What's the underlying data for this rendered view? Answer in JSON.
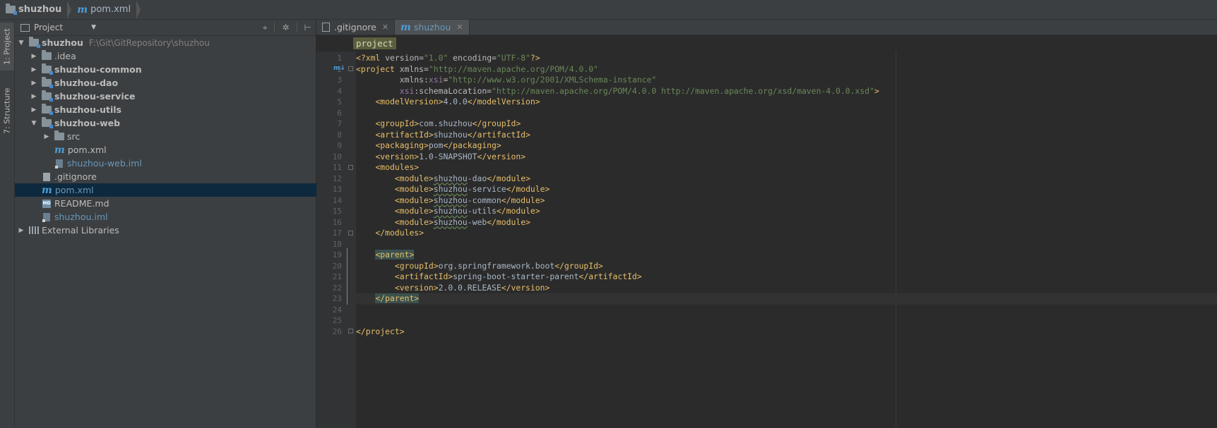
{
  "navbar": {
    "crumbs": [
      {
        "label": "shuzhou",
        "icon": "module-folder-icon"
      },
      {
        "label": "pom.xml",
        "icon": "maven-icon"
      }
    ]
  },
  "toolwindows": {
    "project_tab": "1: Project",
    "structure_tab": "7: Structure"
  },
  "project_panel": {
    "view": "Project",
    "tools": [
      "target-icon",
      "gear-icon",
      "collapse-icon"
    ],
    "tree": [
      {
        "label": "shuzhou",
        "path": "F:\\Git\\GitRepository\\shuzhou",
        "level": 0,
        "expanded": true,
        "bold": true,
        "icon": "module-folder-icon"
      },
      {
        "label": ".idea",
        "level": 1,
        "expanded": false,
        "bold": false,
        "icon": "folder-icon"
      },
      {
        "label": "shuzhou-common",
        "level": 1,
        "expanded": false,
        "bold": true,
        "icon": "module-folder-icon"
      },
      {
        "label": "shuzhou-dao",
        "level": 1,
        "expanded": false,
        "bold": true,
        "icon": "module-folder-icon"
      },
      {
        "label": "shuzhou-service",
        "level": 1,
        "expanded": false,
        "bold": true,
        "icon": "module-folder-icon"
      },
      {
        "label": "shuzhou-utils",
        "level": 1,
        "expanded": false,
        "bold": true,
        "icon": "module-folder-icon"
      },
      {
        "label": "shuzhou-web",
        "level": 1,
        "expanded": true,
        "bold": true,
        "icon": "module-folder-icon"
      },
      {
        "label": "src",
        "level": 2,
        "expanded": false,
        "bold": false,
        "icon": "folder-icon"
      },
      {
        "label": "pom.xml",
        "level": 2,
        "leaf": true,
        "icon": "maven-icon"
      },
      {
        "label": "shuzhou-web.iml",
        "level": 2,
        "leaf": true,
        "icon": "iml-file-icon",
        "blue": true
      },
      {
        "label": ".gitignore",
        "level": 1,
        "leaf": true,
        "icon": "text-file-icon"
      },
      {
        "label": "pom.xml",
        "level": 1,
        "leaf": true,
        "icon": "maven-icon",
        "selected": true
      },
      {
        "label": "README.md",
        "level": 1,
        "leaf": true,
        "icon": "markdown-file-icon"
      },
      {
        "label": "shuzhou.iml",
        "level": 1,
        "leaf": true,
        "icon": "iml-file-icon",
        "blue": true
      },
      {
        "label": "External Libraries",
        "level": 0,
        "expanded": false,
        "bold": false,
        "icon": "library-icon"
      }
    ]
  },
  "editor": {
    "tabs": [
      {
        "label": ".gitignore",
        "icon": "text-file-icon",
        "active": false
      },
      {
        "label": "shuzhou",
        "icon": "maven-icon",
        "active": true
      }
    ],
    "breadcrumb": "project",
    "lines": [
      "1",
      "2",
      "3",
      "4",
      "5",
      "6",
      "7",
      "8",
      "9",
      "10",
      "11",
      "12",
      "13",
      "14",
      "15",
      "16",
      "17",
      "18",
      "19",
      "20",
      "21",
      "22",
      "23",
      "24",
      "25",
      "26"
    ],
    "code": {
      "l1": {
        "pi_open": "<?xml ",
        "v_attr": "version=",
        "v_val": "\"1.0\"",
        "e_attr": " encoding=",
        "e_val": "\"UTF-8\"",
        "pi_close": "?>"
      },
      "l2": {
        "open": "<project ",
        "attr": "xmlns=",
        "val": "\"http://maven.apache.org/POM/4.0.0\""
      },
      "l3": {
        "indent": "         ",
        "attr": "xmlns:",
        "ns": "xsi",
        "eq": "=",
        "val": "\"http://www.w3.org/2001/XMLSchema-instance\""
      },
      "l4": {
        "indent": "         ",
        "ns": "xsi",
        "attr": ":schemaLocation=",
        "val": "\"http://maven.apache.org/POM/4.0.0 http://maven.apache.org/xsd/maven-4.0.0.xsd\"",
        "close": ">"
      },
      "l5": {
        "indent": "    ",
        "open": "<modelVersion>",
        "text": "4.0.0",
        "close": "</modelVersion>"
      },
      "l7": {
        "indent": "    ",
        "open": "<groupId>",
        "text": "com.shuzhou",
        "close": "</groupId>"
      },
      "l8": {
        "indent": "    ",
        "open": "<artifactId>",
        "text": "shuzhou",
        "close": "</artifactId>"
      },
      "l9": {
        "indent": "    ",
        "open": "<packaging>",
        "text": "pom",
        "close": "</packaging>"
      },
      "l10": {
        "indent": "    ",
        "open": "<version>",
        "text": "1.0-SNAPSHOT",
        "close": "</version>"
      },
      "l11": {
        "indent": "    ",
        "open": "<modules>"
      },
      "l12": {
        "indent": "        ",
        "open": "<module>",
        "word": "shuzhou",
        "rest": "-dao",
        "close": "</module>"
      },
      "l13": {
        "indent": "        ",
        "open": "<module>",
        "word": "shuzhou",
        "rest": "-service",
        "close": "</module>"
      },
      "l14": {
        "indent": "        ",
        "open": "<module>",
        "word": "shuzhou",
        "rest": "-common",
        "close": "</module>"
      },
      "l15": {
        "indent": "        ",
        "open": "<module>",
        "word": "shuzhou",
        "rest": "-utils",
        "close": "</module>"
      },
      "l16": {
        "indent": "        ",
        "open": "<module>",
        "word": "shuzhou",
        "rest": "-web",
        "close": "</module>"
      },
      "l17": {
        "indent": "    ",
        "close": "</modules>"
      },
      "l19": {
        "indent": "    ",
        "lt": "<",
        "name": "parent",
        "gt": ">"
      },
      "l20": {
        "indent": "        ",
        "open": "<groupId>",
        "text": "org.springframework.boot",
        "close": "</groupId>"
      },
      "l21": {
        "indent": "        ",
        "open": "<artifactId>",
        "text": "spring-boot-starter-parent",
        "close": "</artifactId>"
      },
      "l22": {
        "indent": "        ",
        "open": "<version>",
        "text": "2.0.0.RELEASE",
        "close": "</version>"
      },
      "l23": {
        "indent": "    ",
        "close": "</parent>"
      },
      "l26": {
        "close": "</project>"
      }
    }
  },
  "colors": {
    "background": "#2b2b2b",
    "panel": "#3c3f41",
    "selection": "#0d293e",
    "tag": "#e8bf6a",
    "string": "#6a8759",
    "namespace": "#9876aa",
    "link_blue": "#6897bb"
  }
}
